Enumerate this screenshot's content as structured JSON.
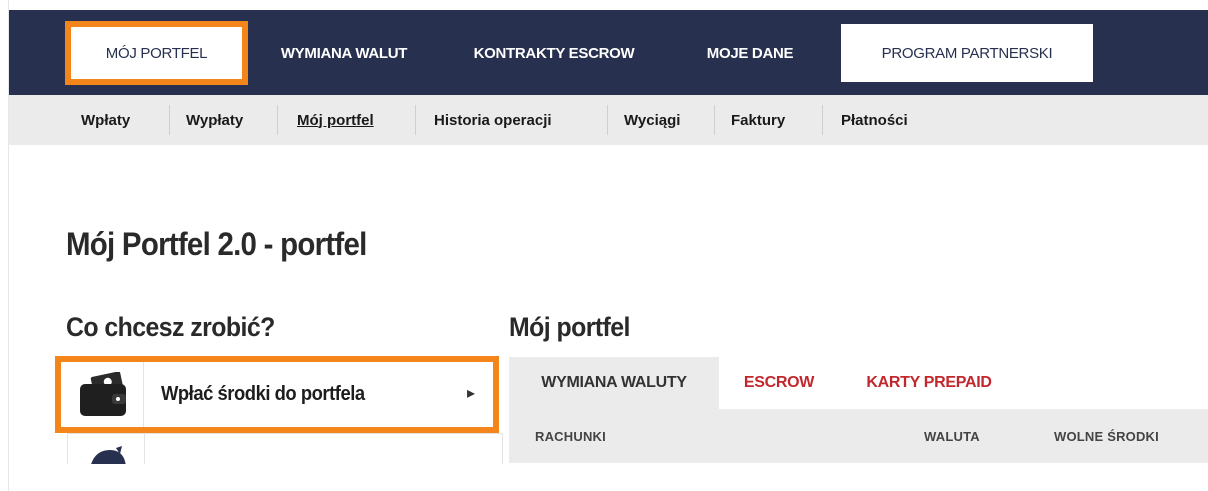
{
  "top_nav": {
    "items": [
      {
        "label": "MÓJ PORTFEL"
      },
      {
        "label": "WYMIANA WALUT"
      },
      {
        "label": "KONTRAKTY ESCROW"
      },
      {
        "label": "MOJE DANE"
      },
      {
        "label": "PROGRAM PARTNERSKI"
      }
    ]
  },
  "sub_nav": {
    "items": [
      {
        "label": "Wpłaty"
      },
      {
        "label": "Wypłaty"
      },
      {
        "label": "Mój portfel"
      },
      {
        "label": "Historia operacji"
      },
      {
        "label": "Wyciągi"
      },
      {
        "label": "Faktury"
      },
      {
        "label": "Płatności"
      }
    ],
    "active": "Mój portfel"
  },
  "page": {
    "title": "Mój Portfel 2.0 - portfel"
  },
  "actions": {
    "heading": "Co chcesz zrobić?",
    "items": [
      {
        "label": "Wpłać środki do portfela",
        "icon": "wallet-icon"
      },
      {
        "label": "",
        "icon": "piggy-bank-icon"
      }
    ]
  },
  "wallet": {
    "heading": "Mój portfel",
    "tabs": [
      {
        "label": "WYMIANA WALUTY"
      },
      {
        "label": "ESCROW"
      },
      {
        "label": "KARTY PREPAID"
      }
    ],
    "columns": [
      "RACHUNKI",
      "WALUTA",
      "WOLNE ŚRODKI"
    ]
  },
  "colors": {
    "nav_bg": "#27304f",
    "highlight": "#f3851b",
    "tab_red": "#c1272d",
    "subnav_bg": "#ebebeb"
  }
}
